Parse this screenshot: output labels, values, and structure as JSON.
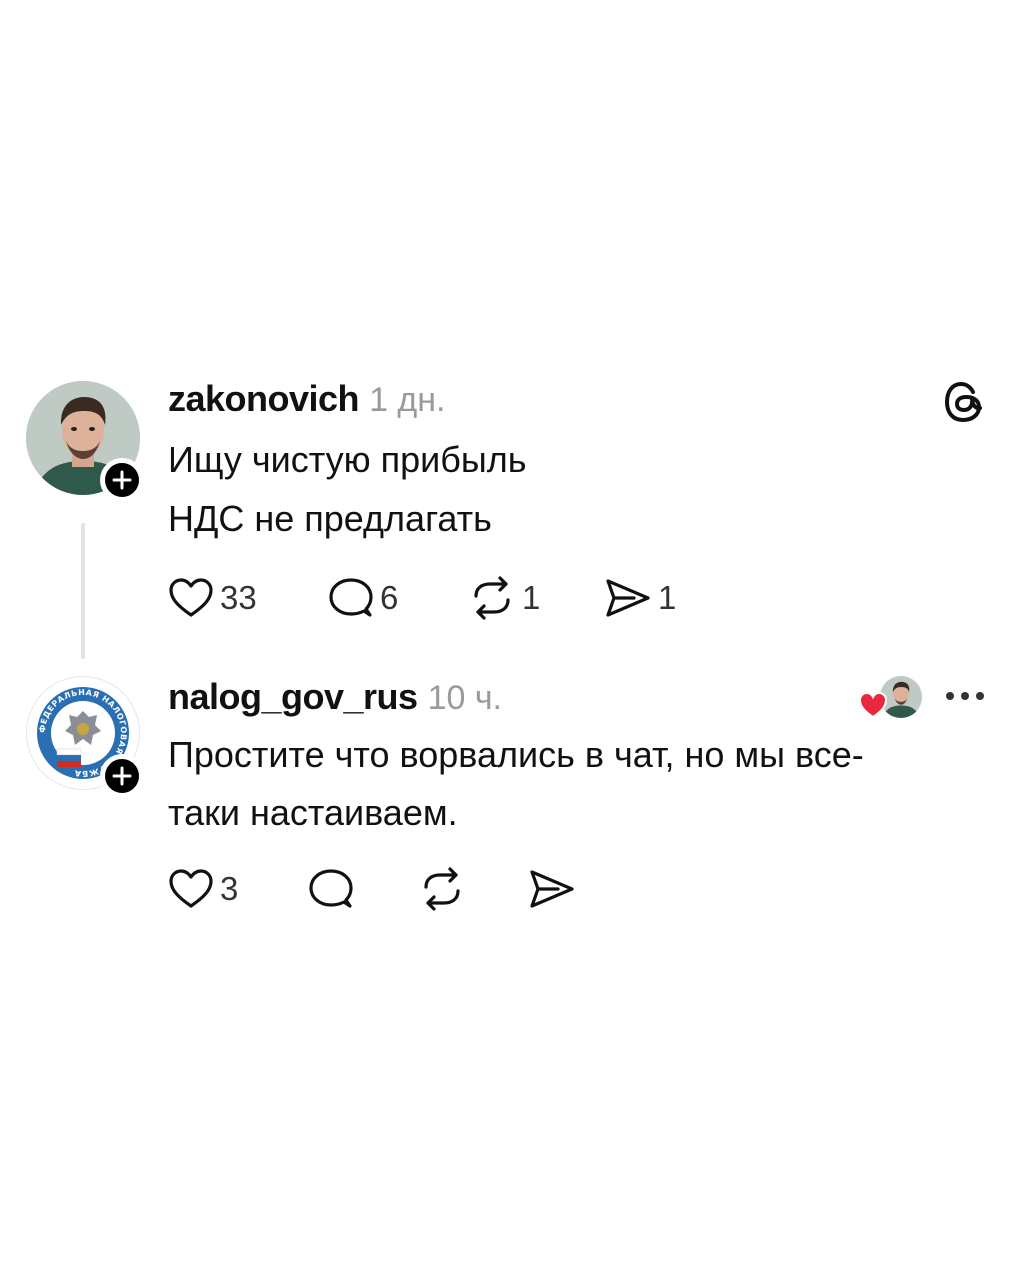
{
  "posts": [
    {
      "username": "zakonovich",
      "timestamp": "1 дн.",
      "lines": [
        "Ищу чистую прибыль",
        "НДС не предлагать"
      ],
      "likes": "33",
      "replies": "6",
      "reposts": "1",
      "shares": "1"
    },
    {
      "username": "nalog_gov_rus",
      "timestamp": "10 ч.",
      "lines": [
        "Простите что ворвались в чат, но мы все-",
        "таки настаиваем."
      ],
      "likes": "3",
      "replies": "",
      "reposts": "",
      "shares": ""
    }
  ],
  "logo_text": "ФЕДЕРАЛЬНАЯ НАЛОГОВАЯ СЛУЖБА",
  "icons": {
    "app_logo": "threads-logo-icon",
    "follow": "plus-icon",
    "like": "heart-outline-icon",
    "reply": "speech-bubble-icon",
    "repost": "repost-arrows-icon",
    "share": "paper-plane-icon",
    "more": "ellipsis-icon",
    "liked_by_author": "red-heart-icon"
  },
  "colors": {
    "text": "#111111",
    "muted": "#9a9a9a",
    "thread_line": "#e3e3e3",
    "heart_red": "#e8283c",
    "badge": "#000000"
  }
}
